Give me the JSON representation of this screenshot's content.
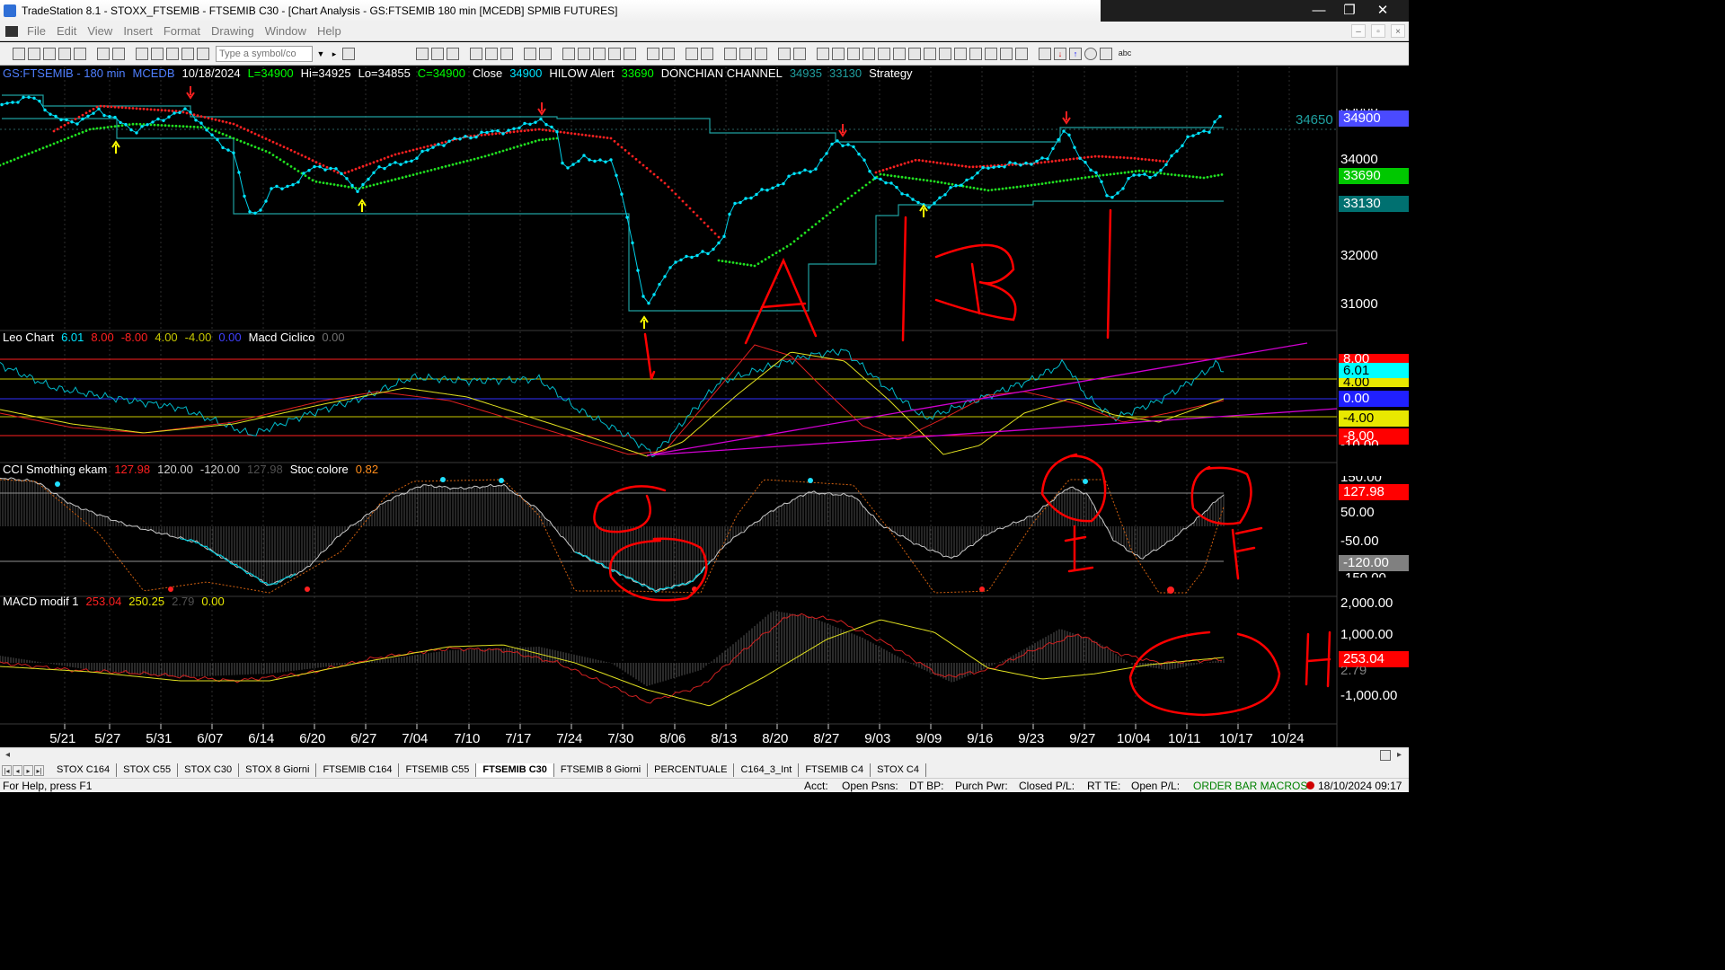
{
  "window": {
    "title": "TradeStation 8.1 - STOXX_FTSEMIB - FTSEMIB C30 - [Chart Analysis - GS:FTSEMIB  180 min  [MCEDB] SPMIB FUTURES]",
    "minimize": "—",
    "maximize": "❐",
    "close": "✕"
  },
  "menu": {
    "items": [
      "File",
      "Edit",
      "View",
      "Insert",
      "Format",
      "Drawing",
      "Window",
      "Help"
    ],
    "mdi_minimize": "–",
    "mdi_restore": "▫",
    "mdi_close": "×"
  },
  "toolbar": {
    "symbol_placeholder": "Type a symbol/co",
    "dropdown_arrow": "▼",
    "go_arrow": "▸",
    "text_tool": "abc"
  },
  "price_pane": {
    "header": [
      {
        "text": "GS:FTSEMIB - 180 min",
        "color": "#4f7fff"
      },
      {
        "text": "MCEDB",
        "color": "#4f7fff"
      },
      {
        "text": "10/18/2024",
        "color": "#ffffff"
      },
      {
        "text": "L=34900",
        "color": "#00ff00"
      },
      {
        "text": "Hi=34925",
        "color": "#ffffff"
      },
      {
        "text": "Lo=34855",
        "color": "#ffffff"
      },
      {
        "text": "C=34900",
        "color": "#00ff00"
      },
      {
        "text": "Close",
        "color": "#ffffff"
      },
      {
        "text": "34900",
        "color": "#00e5ff"
      },
      {
        "text": "HILOW Alert",
        "color": "#ffffff"
      },
      {
        "text": "33690",
        "color": "#00ff00"
      },
      {
        "text": "DONCHIAN CHANNEL",
        "color": "#ffffff"
      },
      {
        "text": "34935",
        "color": "#20a0a0"
      },
      {
        "text": "33130",
        "color": "#20a0a0"
      },
      {
        "text": "Strategy",
        "color": "#ffffff"
      }
    ],
    "axis_labels": [
      "34000",
      "32000",
      "31000"
    ],
    "partial_axis_label": "35000",
    "price_tags": [
      {
        "text": "34900",
        "bg": "#4a4aff",
        "fg": "#ffffff"
      },
      {
        "text": "33690",
        "bg": "#00c800",
        "fg": "#ffffff"
      },
      {
        "text": "33130",
        "bg": "#007070",
        "fg": "#ffffff"
      }
    ],
    "level_readout": "34650"
  },
  "leo_pane": {
    "header": [
      {
        "text": "Leo Chart",
        "color": "#ffffff"
      },
      {
        "text": "6.01",
        "color": "#00e5ff"
      },
      {
        "text": "8.00",
        "color": "#ff2020"
      },
      {
        "text": "-8.00",
        "color": "#ff2020"
      },
      {
        "text": "4.00",
        "color": "#c8c800"
      },
      {
        "text": "-4.00",
        "color": "#c8c800"
      },
      {
        "text": "0.00",
        "color": "#4040ff"
      },
      {
        "text": "Macd Ciclico",
        "color": "#ffffff"
      },
      {
        "text": "0.00",
        "color": "#707070"
      }
    ],
    "tags": [
      {
        "text": "8.00",
        "bg": "#ff0000",
        "fg": "#ffffff"
      },
      {
        "text": "6.01",
        "bg": "#00ffff",
        "fg": "#000000"
      },
      {
        "text": "4.00",
        "bg": "#e8e800",
        "fg": "#000000"
      },
      {
        "text": "0.00",
        "bg": "#2020ff",
        "fg": "#ffffff"
      },
      {
        "text": "-4.00",
        "bg": "#e8e800",
        "fg": "#000000"
      },
      {
        "text": "-8.00",
        "bg": "#ff0000",
        "fg": "#ffffff"
      }
    ],
    "partial_axis_label": "-10.00"
  },
  "cci_pane": {
    "header": [
      {
        "text": "CCI Smothing ekam",
        "color": "#ffffff"
      },
      {
        "text": "127.98",
        "color": "#ff2020"
      },
      {
        "text": "120.00",
        "color": "#d0d0d0"
      },
      {
        "text": "-120.00",
        "color": "#d0d0d0"
      },
      {
        "text": "127.98",
        "color": "#505050"
      },
      {
        "text": "Stoc colore",
        "color": "#ffffff"
      },
      {
        "text": "0.82",
        "color": "#ff8c1a"
      }
    ],
    "axis_labels": [
      "50.00",
      "-50.00"
    ],
    "partial_axis_labels": [
      "150.00",
      "-150.00"
    ],
    "tags": [
      {
        "text": "127.98",
        "bg": "#ff0000",
        "fg": "#ffffff"
      },
      {
        "text": "-120.00",
        "bg": "#808080",
        "fg": "#ffffff"
      }
    ]
  },
  "macd_pane": {
    "header": [
      {
        "text": "MACD modif 1",
        "color": "#ffffff"
      },
      {
        "text": "253.04",
        "color": "#ff2020"
      },
      {
        "text": "250.25",
        "color": "#e8e800"
      },
      {
        "text": "2.79",
        "color": "#505050"
      },
      {
        "text": "0.00",
        "color": "#e8e800"
      }
    ],
    "axis_labels": [
      "2,000.00",
      "1,000.00",
      "-1,000.00"
    ],
    "partial_axis_label": "2.79",
    "tags": [
      {
        "text": "253.04",
        "bg": "#ff0000",
        "fg": "#ffffff"
      }
    ]
  },
  "dates": [
    "5/21",
    "5/27",
    "5/31",
    "6/07",
    "6/14",
    "6/20",
    "6/27",
    "7/04",
    "7/10",
    "7/17",
    "7/24",
    "7/30",
    "8/06",
    "8/13",
    "8/20",
    "8/27",
    "9/03",
    "9/09",
    "9/16",
    "9/23",
    "9/27",
    "10/04",
    "10/11",
    "10/17",
    "10/24"
  ],
  "tabs": [
    "STOX C164",
    "STOX C55",
    "STOX  C30",
    "STOX 8 Giorni",
    "FTSEMIB C164",
    "FTSEMIB C55",
    "FTSEMIB C30",
    "FTSEMIB  8 Giorni",
    "PERCENTUALE",
    "C164_3_Int",
    "FTSEMIB C4",
    "STOX  C4"
  ],
  "active_tab": "FTSEMIB C30",
  "tab_nav": [
    "|◂",
    "◂",
    "▸",
    "▸|"
  ],
  "status": {
    "help": "For Help, press F1",
    "acct": "Acct:",
    "open_psns": "Open Psns:",
    "dt_bp": "DT BP:",
    "purch_pwr": "Purch Pwr:",
    "closed_pl": "Closed P/L:",
    "rt_te": "RT TE:",
    "open_pl": "Open P/L:",
    "macros": "ORDER BAR  MACROS",
    "datetime": "18/10/2024 09:17"
  },
  "colors": {
    "price_line": "#00e5ff",
    "donchian": "#1fa0a0",
    "red_dots": "#ff2020",
    "green_dots": "#20e020",
    "annotation": "#ff0000",
    "trendline": "#d000d0"
  }
}
